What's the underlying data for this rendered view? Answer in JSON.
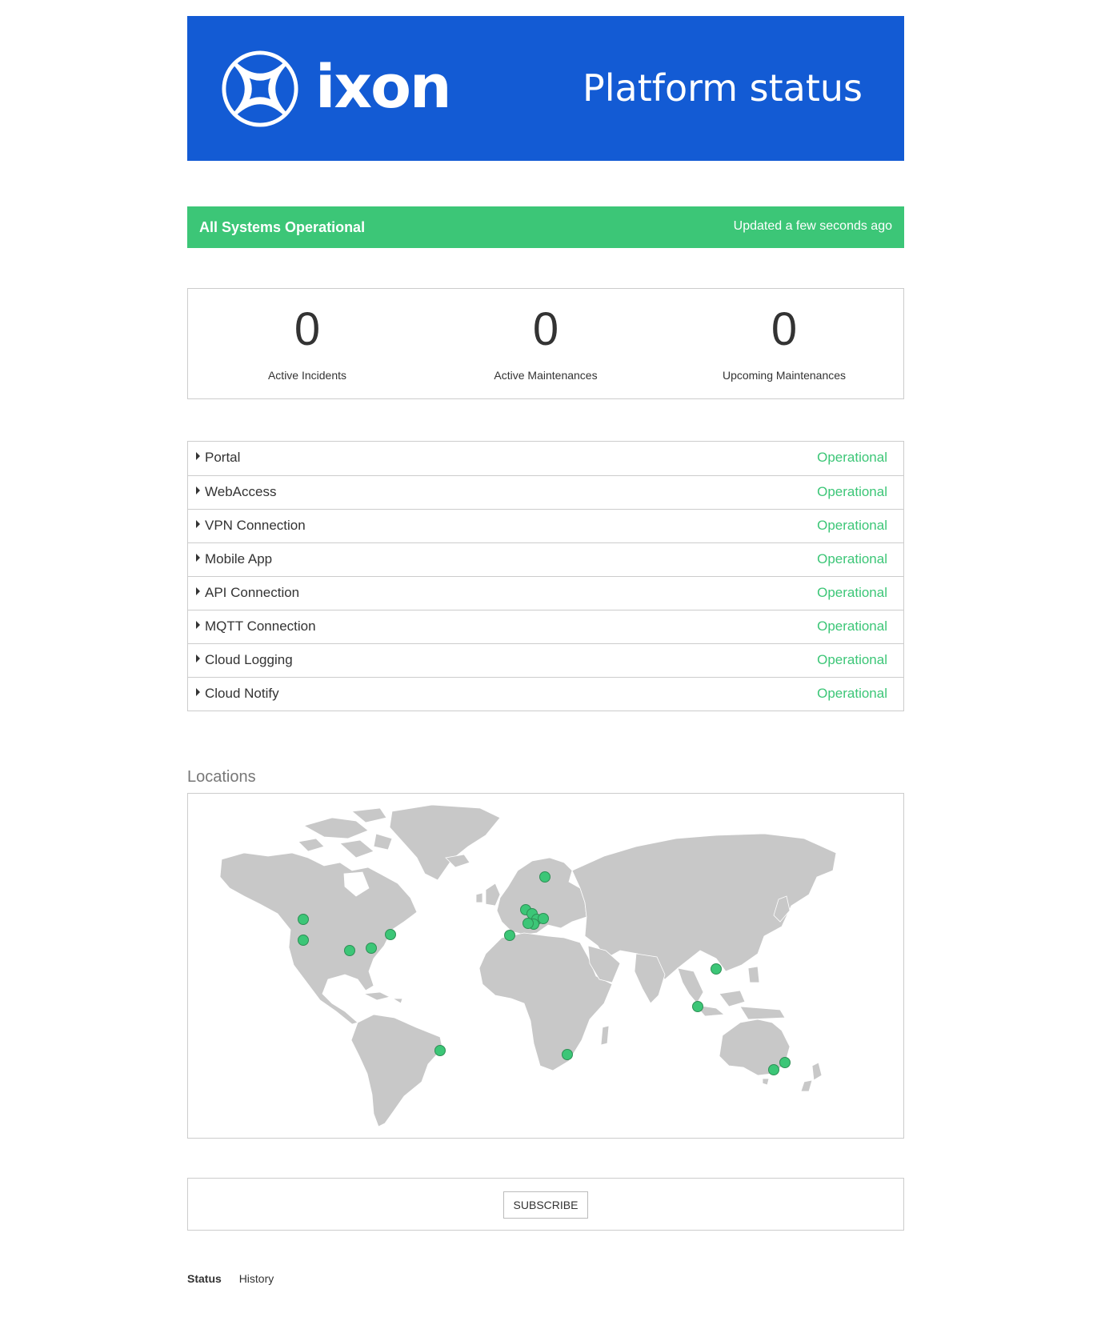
{
  "header": {
    "logo_text": "ixon",
    "title": "Platform status",
    "logo_icon": "ixon-logo-mark",
    "background_color": "#135bd4"
  },
  "status_banner": {
    "title": "All Systems Operational",
    "updated": "Updated a few seconds ago",
    "color": "#3cc677"
  },
  "counters": [
    {
      "value": "0",
      "label": "Active Incidents"
    },
    {
      "value": "0",
      "label": "Active Maintenances"
    },
    {
      "value": "0",
      "label": "Upcoming Maintenances"
    }
  ],
  "components": [
    {
      "name": "Portal",
      "status": "Operational"
    },
    {
      "name": "WebAccess",
      "status": "Operational"
    },
    {
      "name": "VPN Connection",
      "status": "Operational"
    },
    {
      "name": "Mobile App",
      "status": "Operational"
    },
    {
      "name": "API Connection",
      "status": "Operational"
    },
    {
      "name": "MQTT Connection",
      "status": "Operational"
    },
    {
      "name": "Cloud Logging",
      "status": "Operational"
    },
    {
      "name": "Cloud Notify",
      "status": "Operational"
    }
  ],
  "locations": {
    "title": "Locations",
    "marker_color": "#3cc677",
    "land_color": "#c8c8c8"
  },
  "subscribe": {
    "label": "SUBSCRIBE"
  },
  "footer": {
    "links": [
      {
        "label": "Status",
        "active": true
      },
      {
        "label": "History",
        "active": false
      }
    ]
  }
}
